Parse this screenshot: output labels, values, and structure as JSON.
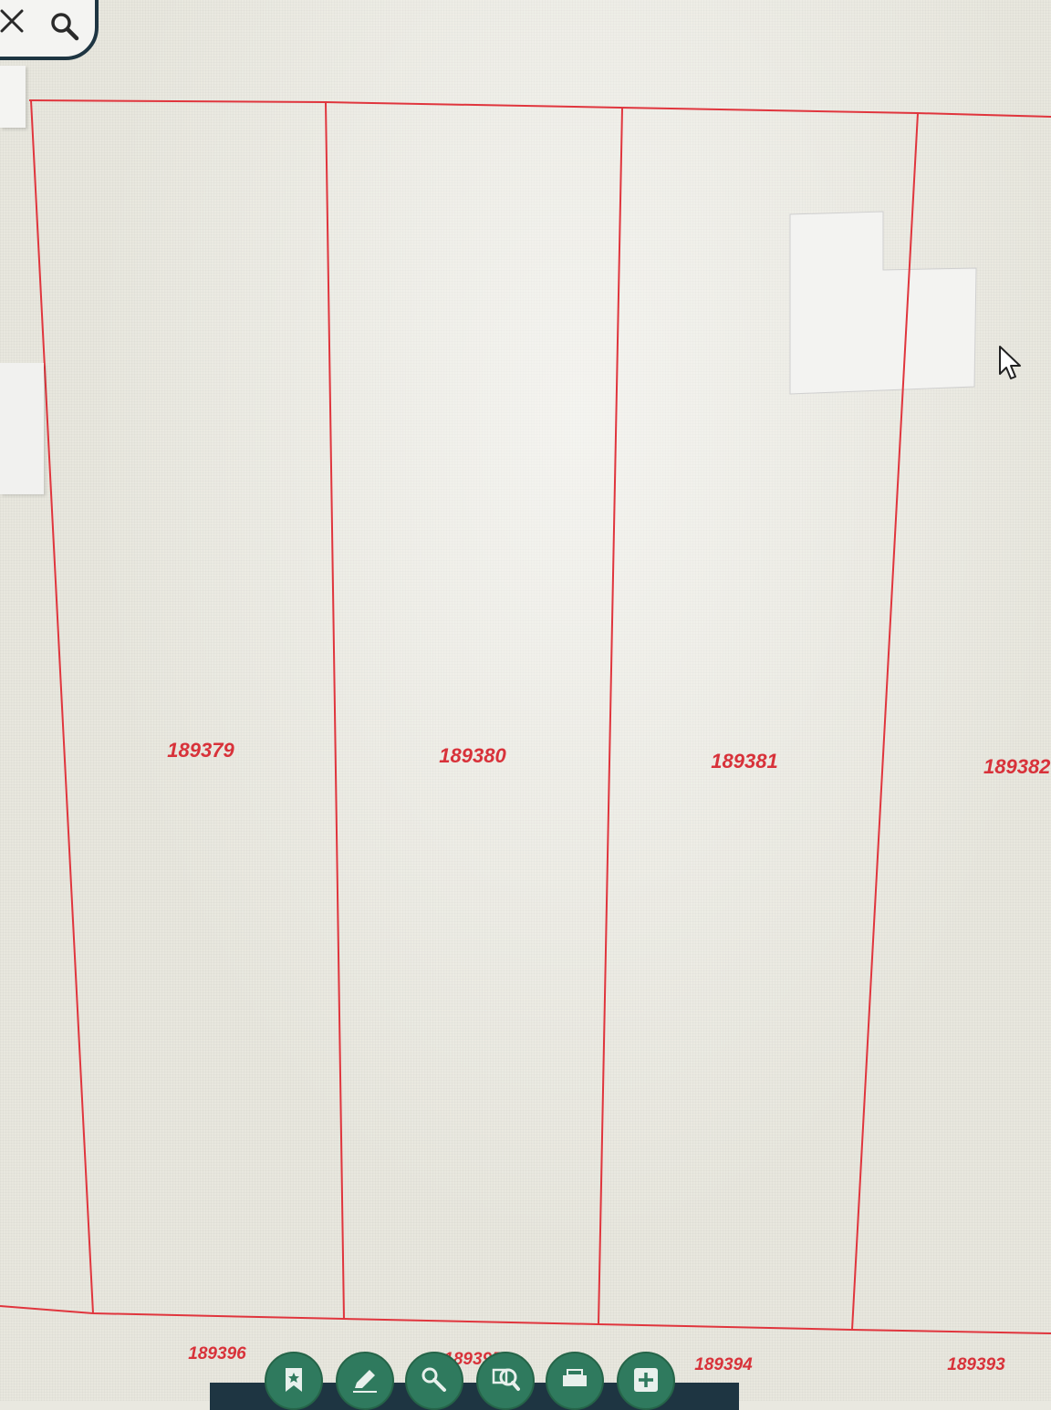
{
  "map": {
    "parcels_top_row": [
      {
        "id": "189379"
      },
      {
        "id": "189380"
      },
      {
        "id": "189381"
      },
      {
        "id": "189382"
      }
    ],
    "parcels_bottom_row": [
      {
        "id": "189396"
      },
      {
        "id": "189395"
      },
      {
        "id": "189394"
      },
      {
        "id": "189393"
      }
    ],
    "parcel_line_color": "#e0353d",
    "label_color": "#d8323a"
  },
  "search": {
    "clear_icon": "close-icon",
    "search_icon": "magnifier-icon"
  },
  "toolbar": {
    "buttons": [
      {
        "name": "bookmark-icon"
      },
      {
        "name": "draw-icon"
      },
      {
        "name": "measure-icon"
      },
      {
        "name": "zoom-to-icon"
      },
      {
        "name": "print-icon"
      },
      {
        "name": "add-icon"
      }
    ],
    "accent_color": "#2f7a5e"
  }
}
